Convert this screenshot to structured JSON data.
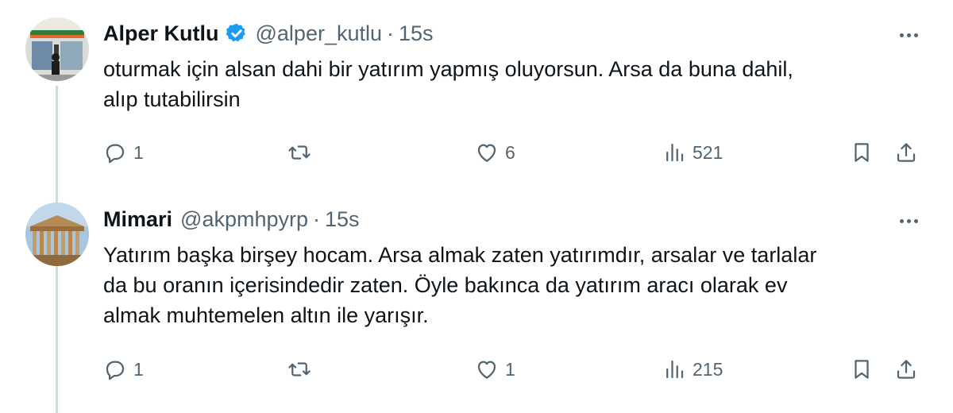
{
  "tweets": [
    {
      "author_name": "Alper Kutlu",
      "verified": true,
      "handle": "@alper_kutlu",
      "separator": "·",
      "time": "15s",
      "text": "oturmak için alsan dahi bir yatırım yapmış oluyorsun. Arsa da buna dahil,\nalıp tutabilirsin",
      "replies": "1",
      "retweets": "",
      "likes": "6",
      "views": "521",
      "avatar_icon": "storefront-photo"
    },
    {
      "author_name": "Mimari",
      "verified": false,
      "handle": "@akpmhpyrp",
      "separator": "·",
      "time": "15s",
      "text": "Yatırım başka birşey hocam. Arsa almak zaten yatırımdır, arsalar ve tarlalar\nda bu oranın içerisindedir zaten. Öyle bakınca da yatırım aracı olarak ev\nalmak muhtemelen altın ile yarışır.",
      "replies": "1",
      "retweets": "",
      "likes": "1",
      "views": "215",
      "avatar_icon": "parthenon-photo"
    }
  ],
  "colors": {
    "text": "#0f1419",
    "secondary": "#536471",
    "verified": "#1d9bf0",
    "thread_line": "#cfd9de"
  }
}
